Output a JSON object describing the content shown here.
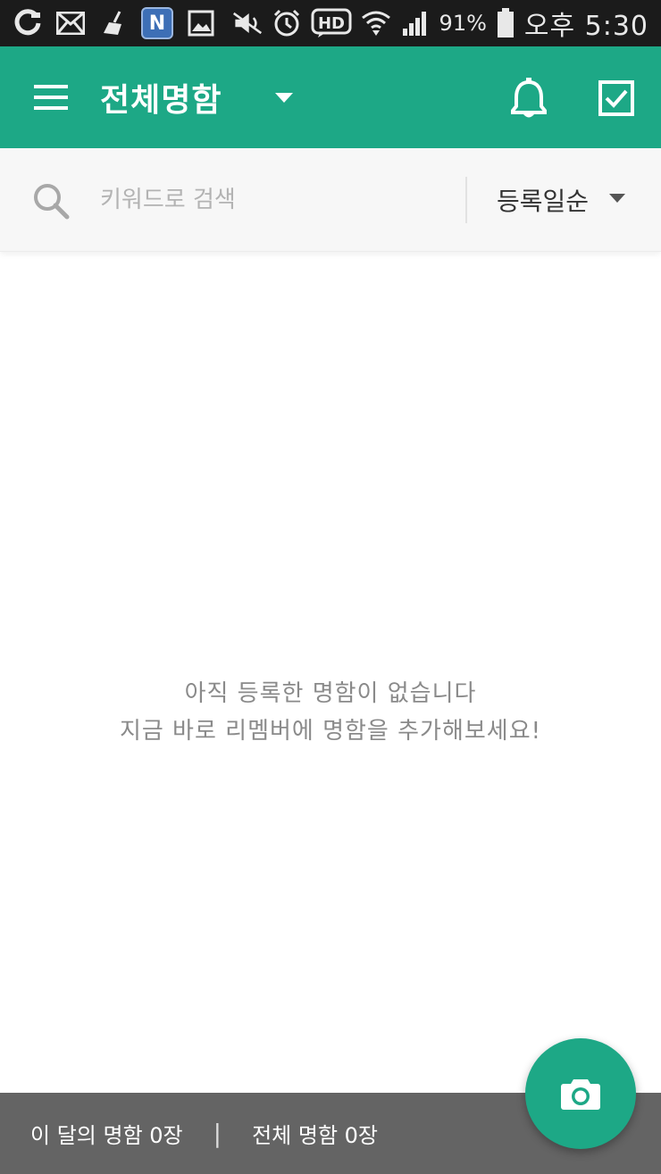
{
  "status_bar": {
    "battery": "91%",
    "time": "오후 5:30",
    "n_label": "N",
    "hd_label": "HD",
    "icons": [
      "o-app-icon",
      "mail-icon",
      "broom-icon",
      "n-app-icon",
      "image-icon",
      "mute-icon",
      "alarm-icon",
      "hd-icon",
      "wifi-icon",
      "signal-icon",
      "battery-icon"
    ]
  },
  "app_bar": {
    "title": "전체명함",
    "color": "#1da886",
    "icons": [
      "menu-icon",
      "dropdown-caret-icon",
      "bell-icon",
      "checkbox-icon"
    ]
  },
  "search": {
    "placeholder": "키워드로 검색",
    "value": "",
    "sort_label": "등록일순"
  },
  "empty_state": {
    "line1": "아직 등록한 명함이 없습니다",
    "line2": "지금 바로 리멤버에 명함을 추가해보세요!"
  },
  "bottom_bar": {
    "month_count": "이 달의 명함 0장",
    "separator": "|",
    "total_count": "전체 명함 0장"
  },
  "fab": {
    "icon": "camera-icon"
  }
}
